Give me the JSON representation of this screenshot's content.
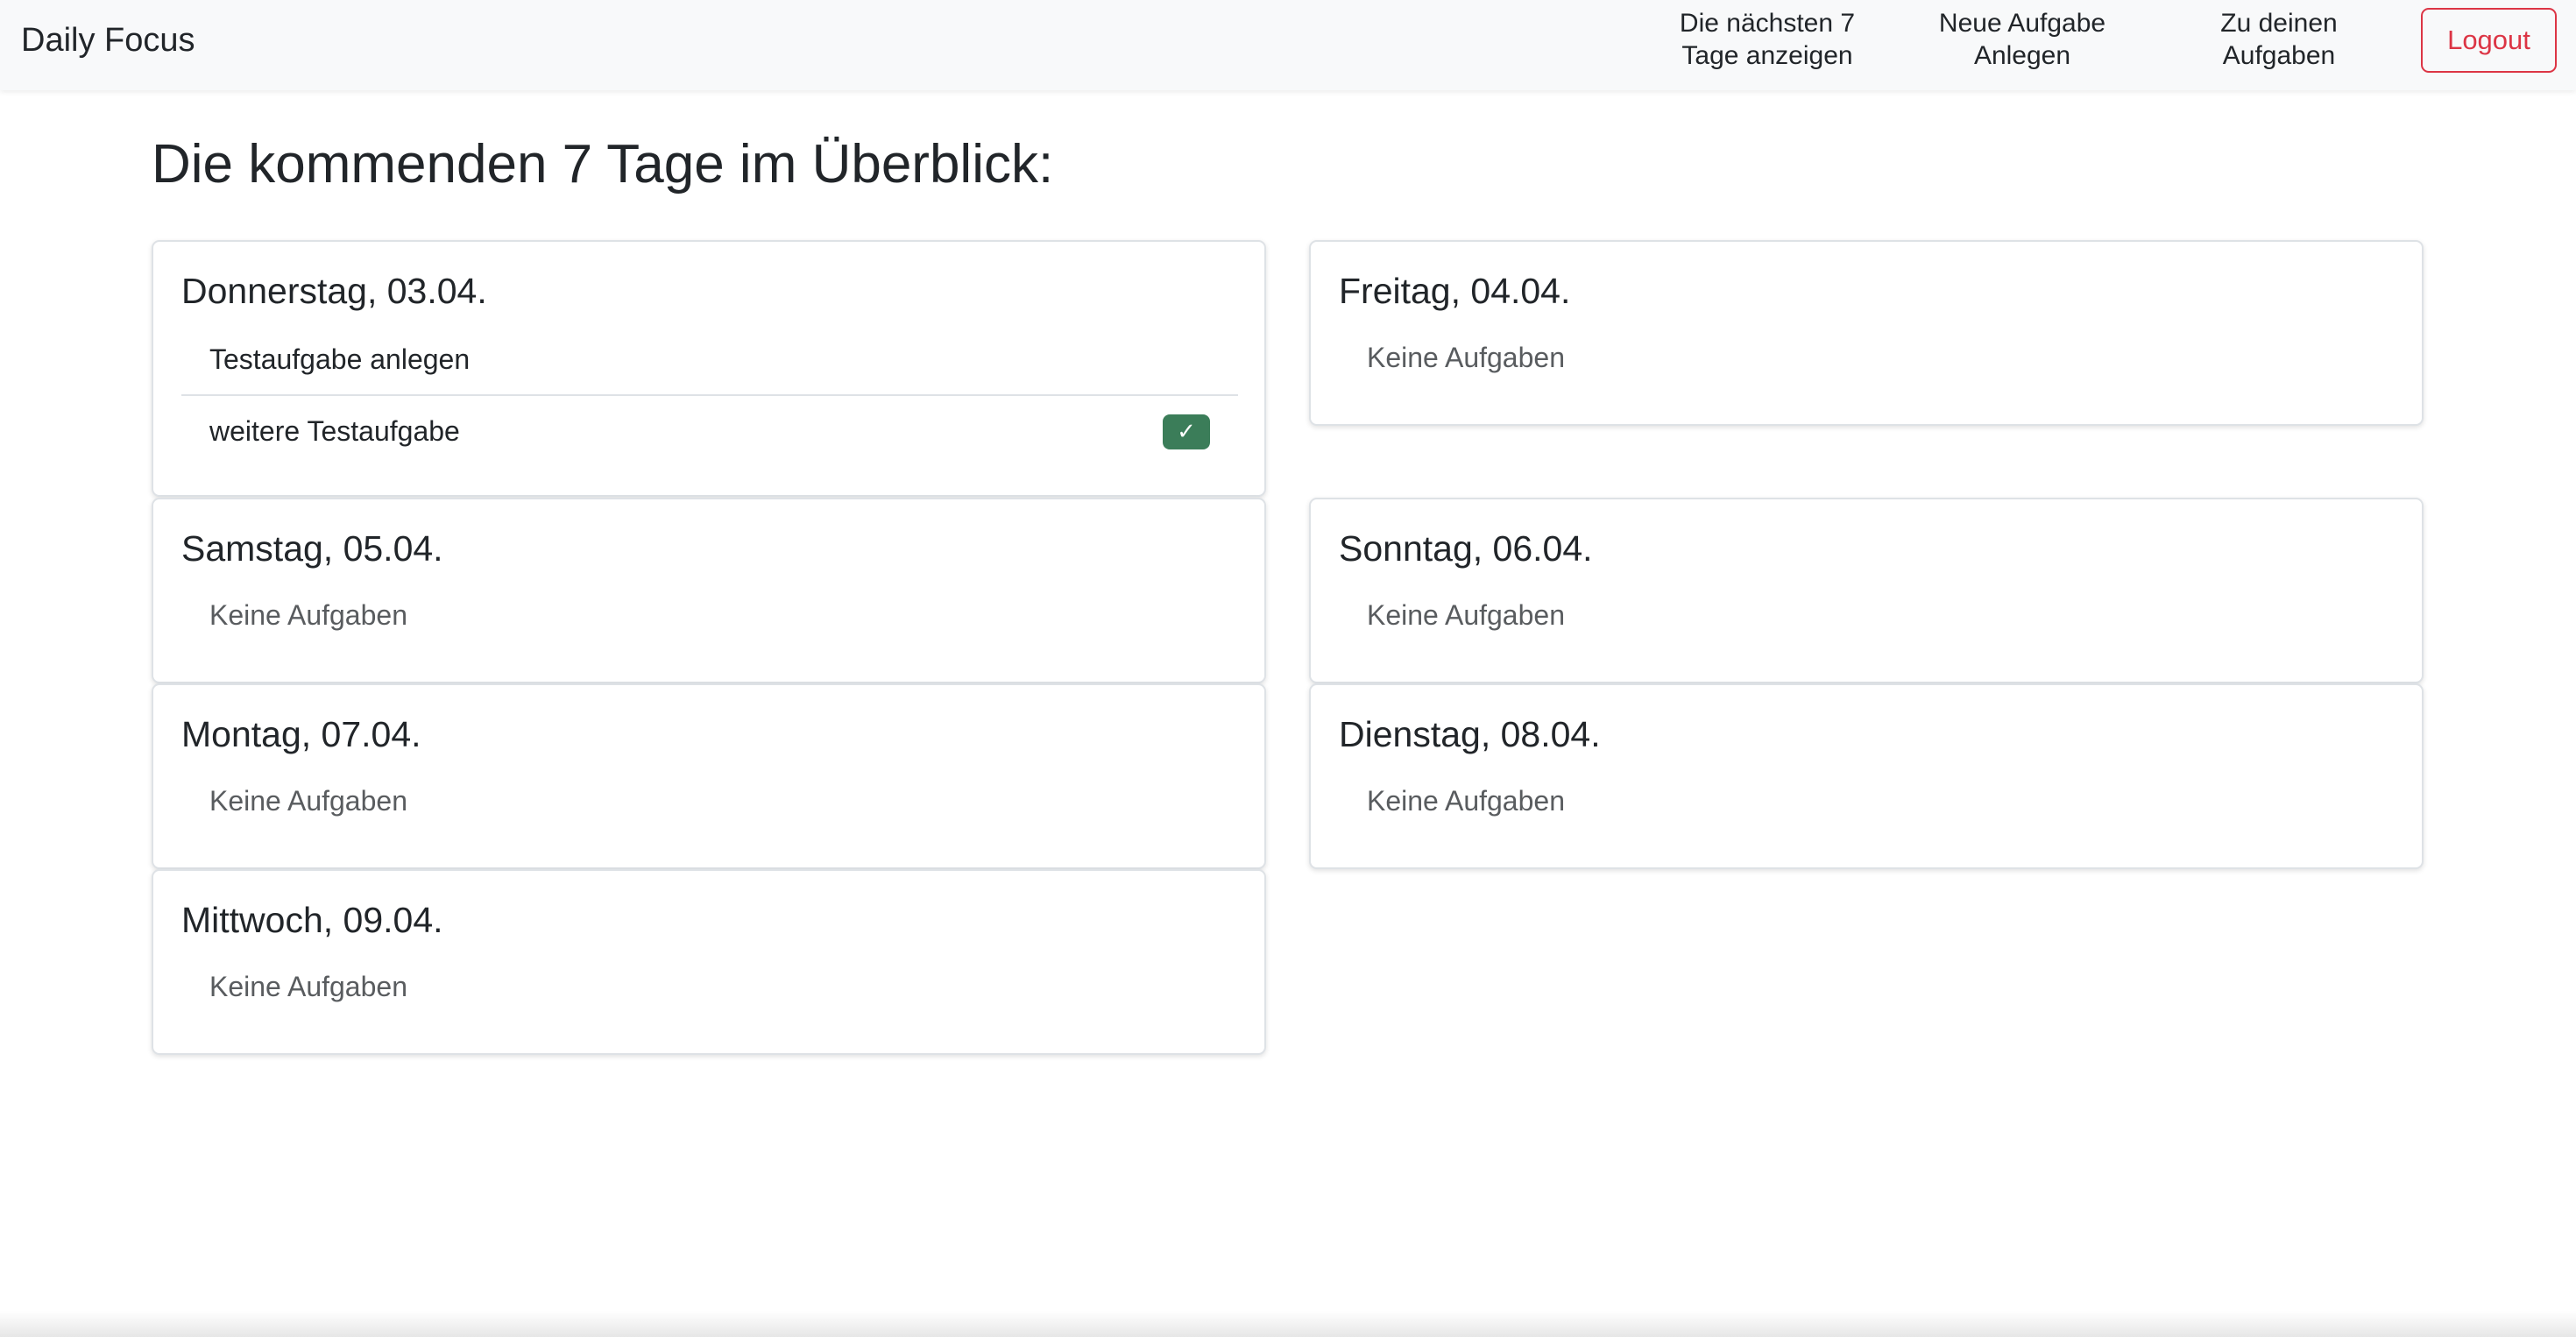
{
  "navbar": {
    "brand": "Daily Focus",
    "links": [
      {
        "line1": "Die nächsten 7",
        "line2": "Tage anzeigen"
      },
      {
        "line1": "Neue Aufgabe",
        "line2": "Anlegen"
      },
      {
        "line1": "Zu deinen",
        "line2": "Aufgaben"
      }
    ],
    "logout_label": "Logout"
  },
  "page": {
    "title": "Die kommenden 7 Tage im Überblick:"
  },
  "days": [
    {
      "title": "Donnerstag, 03.04.",
      "tasks": [
        {
          "label": "Testaufgabe anlegen",
          "done": false
        },
        {
          "label": "weitere Testaufgabe",
          "done": true,
          "badge_icon": "check-icon"
        }
      ]
    },
    {
      "title": "Freitag, 04.04.",
      "empty_text": "Keine Aufgaben"
    },
    {
      "title": "Samstag, 05.04.",
      "empty_text": "Keine Aufgaben"
    },
    {
      "title": "Sonntag, 06.04.",
      "empty_text": "Keine Aufgaben"
    },
    {
      "title": "Montag, 07.04.",
      "empty_text": "Keine Aufgaben"
    },
    {
      "title": "Dienstag, 08.04.",
      "empty_text": "Keine Aufgaben"
    },
    {
      "title": "Mittwoch, 09.04.",
      "empty_text": "Keine Aufgaben"
    }
  ],
  "colors": {
    "danger": "#dc3545",
    "success": "#3b7d59",
    "navbar_bg": "#f8f9fa",
    "muted_text": "#595c5f"
  }
}
